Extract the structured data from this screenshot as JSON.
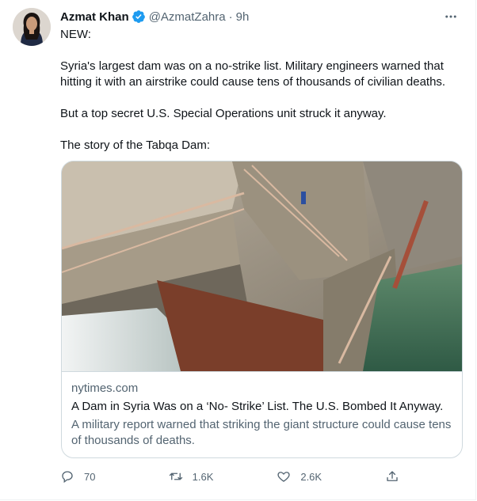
{
  "tweet": {
    "author_name": "Azmat Khan",
    "handle": "@AzmatZahra",
    "separator": "·",
    "time": "9h",
    "paragraphs": [
      "NEW:",
      "Syria's largest dam was on a no-strike list. Military engineers warned that hitting it with an airstrike could cause tens of thousands of civilian deaths.",
      "But a top secret U.S. Special Operations unit struck it anyway.",
      "The story of the Tabqa Dam:"
    ]
  },
  "card": {
    "domain": "nytimes.com",
    "title": "A Dam in Syria Was on a ‘No- Strike’ List. The U.S. Bombed It Anyway.",
    "description": "A military report warned that striking the giant structure could cause tens of thousands of deaths."
  },
  "actions": {
    "replies": "70",
    "retweets": "1.6K",
    "likes": "2.6K"
  },
  "colors": {
    "text": "#0f1419",
    "secondary": "#536471",
    "verified": "#1d9bf0",
    "border": "#cfd9de"
  }
}
